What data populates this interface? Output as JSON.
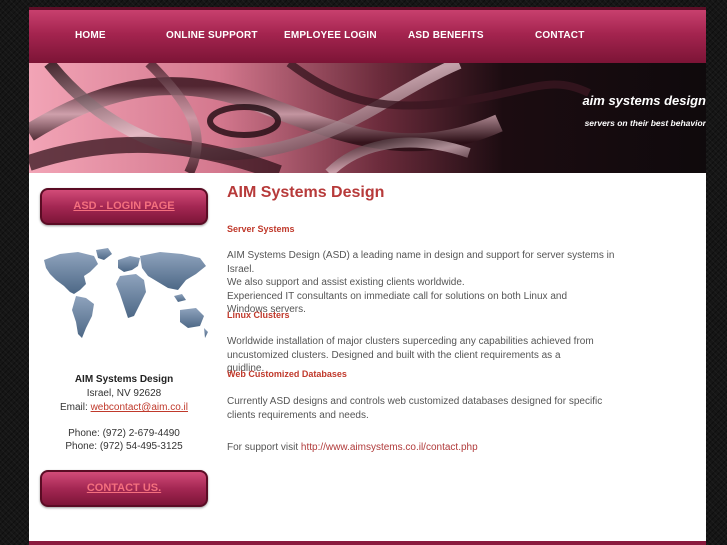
{
  "nav": {
    "items": [
      {
        "label": "HOME"
      },
      {
        "label": "ONLINE SUPPORT"
      },
      {
        "label": "EMPLOYEE LOGIN"
      },
      {
        "label": "ASD BENEFITS"
      },
      {
        "label": "CONTACT"
      }
    ]
  },
  "banner": {
    "title": "aim systems design",
    "tagline": "servers on their best behavior"
  },
  "sidebar": {
    "login_button": "ASD - LOGIN PAGE",
    "company": "AIM Systems Design",
    "city": "Israel, NV 92628",
    "email_label": "Email:",
    "email": "webcontact@aim.co.il",
    "phone1": "Phone: (972) 2-679-4490",
    "phone2": "Phone: (972) 54-495-3125",
    "contact_button": "CONTACT US."
  },
  "main": {
    "title": "AIM Systems Design",
    "sections": [
      {
        "heading": "Server Systems",
        "paragraphs": [
          "AIM Systems Design (ASD) a leading name in design and support for server systems in Israel.",
          "We also support and assist existing clients worldwide.",
          "Experienced IT consultants on immediate call for solutions on both Linux and Windows servers."
        ]
      },
      {
        "heading": "Linux Clusters",
        "paragraphs": [
          "Worldwide installation of major clusters superceding any capabilities achieved from uncustomized clusters. Designed and built with the client requirements as a guidline."
        ]
      },
      {
        "heading": "Web Customized Databases",
        "paragraphs": [
          "Currently ASD designs and controls web customized databases designed for specific clients requirements and needs."
        ]
      }
    ],
    "support_text": "For support visit",
    "support_url": "http://www.aimsystems.co.il/contact.php"
  },
  "colors": {
    "accent": "#a42753",
    "heading": "#b73a3a",
    "link": "#c0392b"
  }
}
